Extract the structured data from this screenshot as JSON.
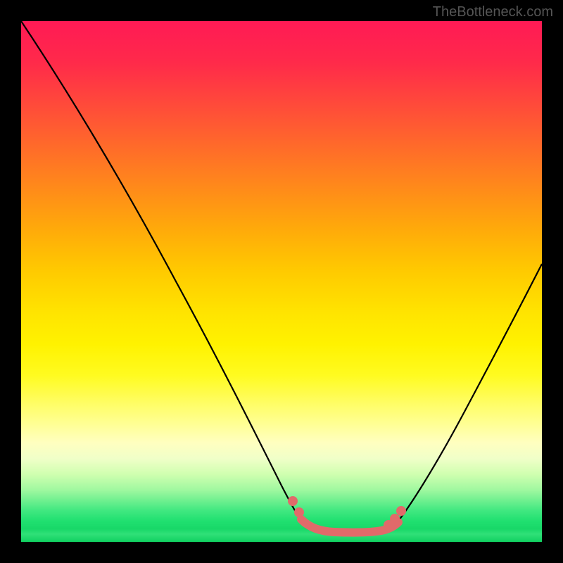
{
  "watermark": "TheBottleneck.com",
  "chart_data": {
    "type": "line",
    "title": "",
    "xlabel": "",
    "ylabel": "",
    "xlim": [
      0,
      100
    ],
    "ylim": [
      0,
      100
    ],
    "background": "rainbow-gradient-red-to-green-vertical",
    "series": [
      {
        "name": "left-descending-curve",
        "color": "#000000",
        "x": [
          0,
          10,
          20,
          30,
          40,
          48,
          52
        ],
        "y": [
          100,
          86,
          70,
          52,
          32,
          12,
          3
        ]
      },
      {
        "name": "right-ascending-curve",
        "color": "#000000",
        "x": [
          72,
          78,
          85,
          92,
          100
        ],
        "y": [
          3,
          12,
          26,
          42,
          57
        ]
      },
      {
        "name": "bottom-flat-highlight",
        "color": "#e16a6a",
        "thick": true,
        "x": [
          52,
          55,
          58,
          60,
          63,
          66,
          69,
          72
        ],
        "y": [
          3,
          2,
          2,
          2,
          2,
          2,
          2.5,
          3
        ]
      }
    ],
    "markers": [
      {
        "x": 50,
        "y": 8,
        "color": "#e16a6a"
      },
      {
        "x": 51.5,
        "y": 5,
        "color": "#e16a6a"
      },
      {
        "x": 70,
        "y": 3,
        "color": "#e16a6a"
      },
      {
        "x": 71.5,
        "y": 4.5,
        "color": "#e16a6a"
      },
      {
        "x": 73,
        "y": 6.5,
        "color": "#e16a6a"
      }
    ]
  }
}
